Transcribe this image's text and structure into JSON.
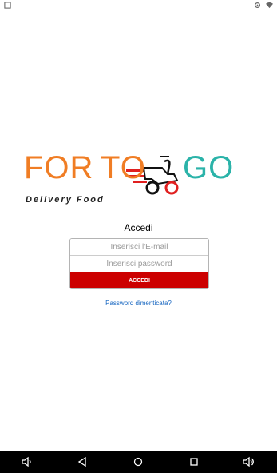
{
  "brand": {
    "part1": "FOR",
    "part2": "TO",
    "part3": "GO",
    "tagline": "Delivery Food",
    "colors": {
      "orange": "#f07d24",
      "teal": "#2bb3a9",
      "dark": "#222222"
    }
  },
  "login": {
    "title": "Accedi",
    "email_placeholder": "Inserisci l'E-mail",
    "password_placeholder": "Inserisci password",
    "submit_label": "ACCEDI",
    "forgot_label": "Password dimenticata?"
  },
  "theme": {
    "accent": "#cc0000",
    "link": "#1565c0"
  },
  "status_bar": {
    "icons": [
      "notification-icon",
      "settings-icon",
      "wifi-icon"
    ]
  },
  "nav_bar": {
    "icons": [
      "volume-down-icon",
      "back-icon",
      "home-icon",
      "recents-icon",
      "volume-up-icon"
    ]
  }
}
